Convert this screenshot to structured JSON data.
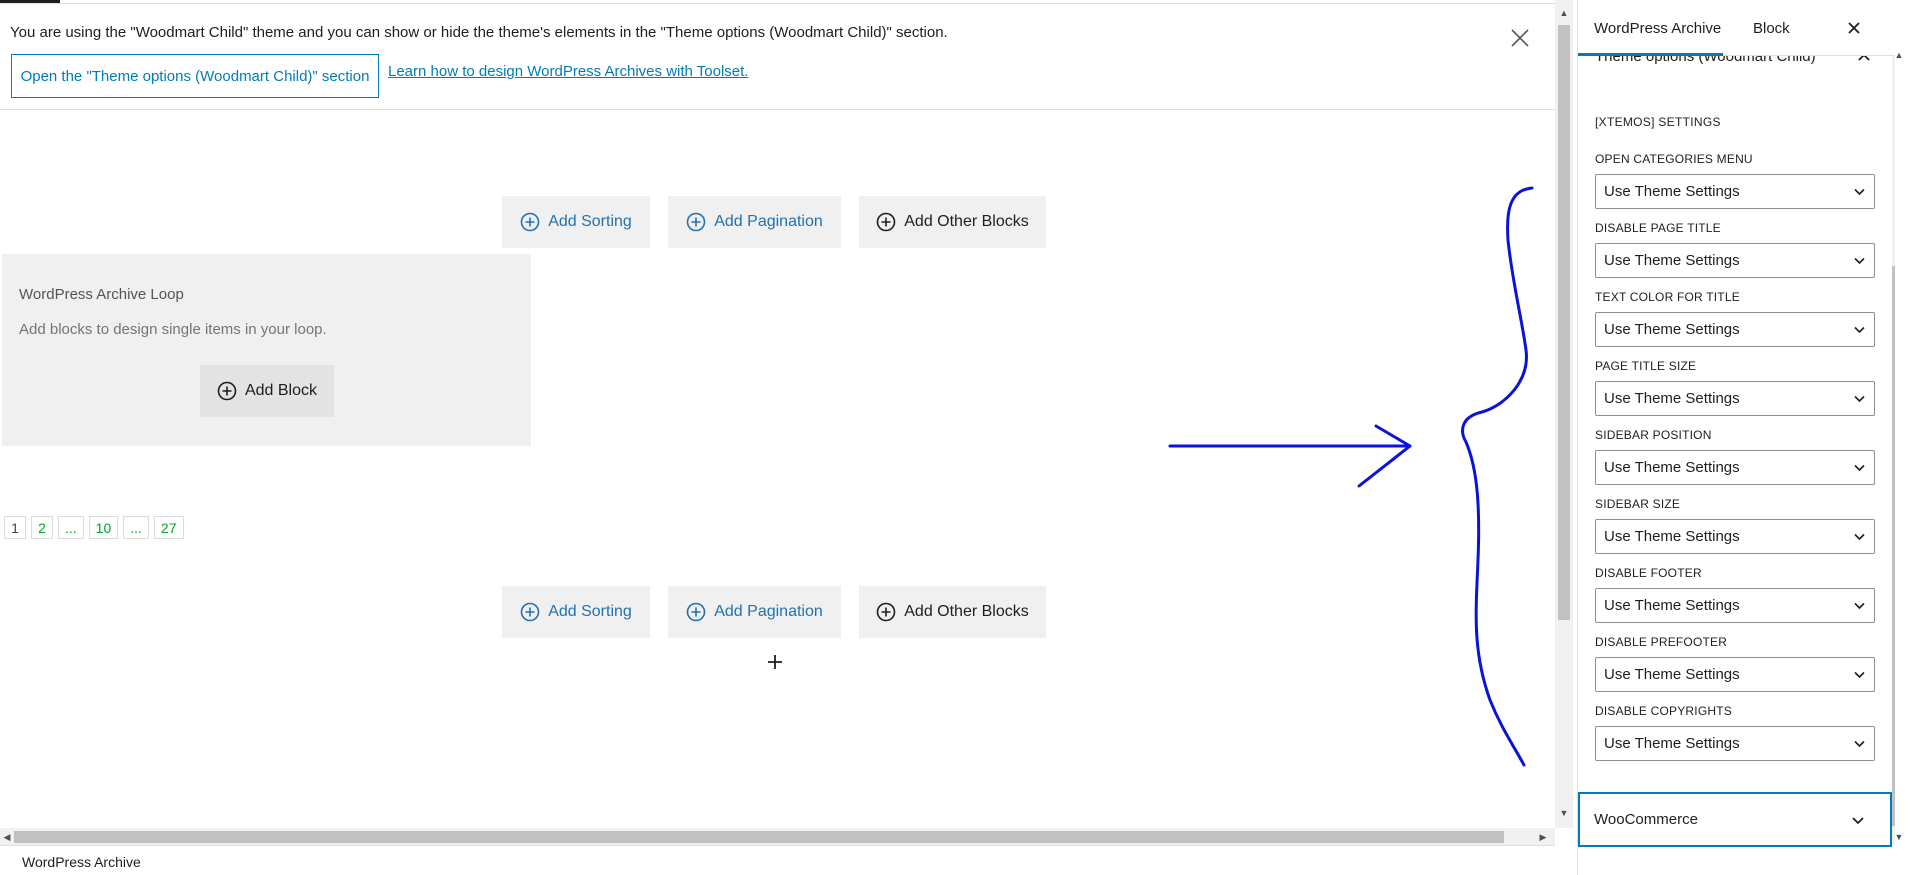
{
  "notice": {
    "message": "You are using the \"Woodmart Child\" theme and you can show or hide the theme's elements in the \"Theme options (Woodmart Child)\" section.",
    "open_section_label": "Open the \"Theme options (Woodmart Child)\" section",
    "learn_link": "Learn how to design WordPress Archives with Toolset.",
    "close_icon": "close-icon"
  },
  "toolbar_top": {
    "add_sorting": "Add Sorting",
    "add_pagination": "Add Pagination",
    "add_other_blocks": "Add Other Blocks"
  },
  "loop": {
    "title": "WordPress Archive Loop",
    "description": "Add blocks to design single items in your loop.",
    "add_block": "Add Block"
  },
  "pagination": [
    "1",
    "2",
    "...",
    "10",
    "...",
    "27"
  ],
  "toolbar_bottom": {
    "add_sorting": "Add Sorting",
    "add_pagination": "Add Pagination",
    "add_other_blocks": "Add Other Blocks"
  },
  "footer": {
    "breadcrumb": "WordPress Archive"
  },
  "sidebar": {
    "tabs": [
      {
        "label": "WordPress Archive",
        "active": true
      },
      {
        "label": "Block",
        "active": false
      }
    ],
    "panel_title": "Theme options (Woodmart Child)",
    "section_heading": "[XTEMOS] SETTINGS",
    "fields": [
      {
        "label": "OPEN CATEGORIES MENU",
        "value": "Use Theme Settings"
      },
      {
        "label": "DISABLE PAGE TITLE",
        "value": "Use Theme Settings"
      },
      {
        "label": "TEXT COLOR FOR TITLE",
        "value": "Use Theme Settings"
      },
      {
        "label": "PAGE TITLE SIZE",
        "value": "Use Theme Settings"
      },
      {
        "label": "SIDEBAR POSITION",
        "value": "Use Theme Settings"
      },
      {
        "label": "SIDEBAR SIZE",
        "value": "Use Theme Settings"
      },
      {
        "label": "DISABLE FOOTER",
        "value": "Use Theme Settings"
      },
      {
        "label": "DISABLE PREFOOTER",
        "value": "Use Theme Settings"
      },
      {
        "label": "DISABLE COPYRIGHTS",
        "value": "Use Theme Settings"
      }
    ],
    "woocommerce_panel": "WooCommerce"
  },
  "colors": {
    "accent": "#007cba",
    "link_blue": "#2271b1",
    "pager_green": "#00a32a",
    "annotation_ink": "#0a14d8",
    "block_bg": "#f0f0f0"
  }
}
